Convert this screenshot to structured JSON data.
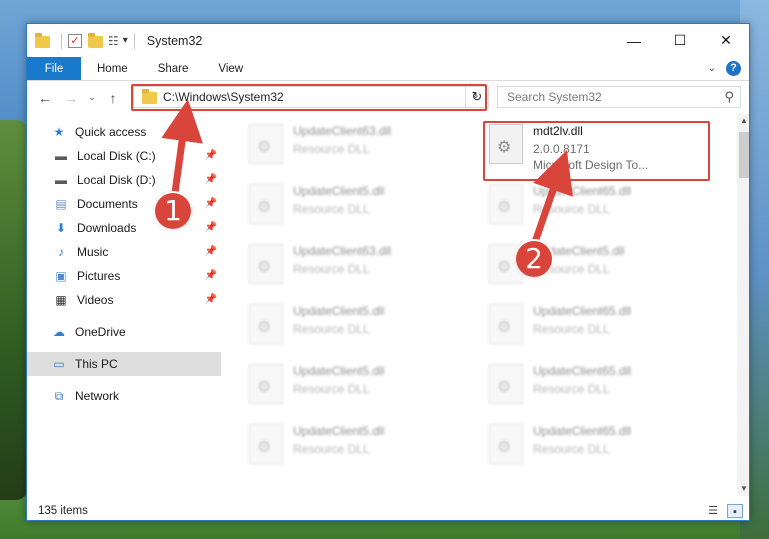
{
  "window": {
    "title": "System32",
    "controls": {
      "minimize": "—",
      "maximize": "☐",
      "close": "✕"
    }
  },
  "ribbon": {
    "file_tab": "File",
    "tabs": [
      "Home",
      "Share",
      "View"
    ]
  },
  "navigation": {
    "back": "←",
    "forward": "→",
    "recent": "⌄",
    "up": "↑",
    "address": "C:\\Windows\\System32",
    "refresh": "↻",
    "search_placeholder": "Search System32"
  },
  "sidebar": {
    "items": [
      {
        "label": "Quick access",
        "icon": "star-icon",
        "pinned": false,
        "level": "top"
      },
      {
        "label": "Local Disk (C:)",
        "icon": "drive-icon",
        "pinned": true,
        "level": "child"
      },
      {
        "label": "Local Disk (D:)",
        "icon": "drive-icon",
        "pinned": true,
        "level": "child"
      },
      {
        "label": "Documents",
        "icon": "documents-icon",
        "pinned": true,
        "level": "child"
      },
      {
        "label": "Downloads",
        "icon": "download-icon",
        "pinned": true,
        "level": "child"
      },
      {
        "label": "Music",
        "icon": "music-icon",
        "pinned": true,
        "level": "child"
      },
      {
        "label": "Pictures",
        "icon": "pictures-icon",
        "pinned": true,
        "level": "child"
      },
      {
        "label": "Videos",
        "icon": "videos-icon",
        "pinned": true,
        "level": "child"
      },
      {
        "label": "OneDrive",
        "icon": "cloud-icon",
        "pinned": false,
        "level": "top"
      },
      {
        "label": "This PC",
        "icon": "computer-icon",
        "pinned": false,
        "level": "top",
        "selected": true
      },
      {
        "label": "Network",
        "icon": "network-icon",
        "pinned": false,
        "level": "top"
      }
    ]
  },
  "files": {
    "highlighted": {
      "name": "mdt2lv.dll",
      "version": "2.0.0.8171",
      "description": "Microsoft Design To..."
    },
    "left_column": [
      {
        "name": "UpdateClient63.dll",
        "type": "Resource DLL"
      },
      {
        "name": "UpdateClient5.dll",
        "type": "Resource DLL"
      },
      {
        "name": "UpdateClient63.dll",
        "type": "Resource DLL"
      },
      {
        "name": "UpdateClient5.dll",
        "type": "Resource DLL"
      },
      {
        "name": "UpdateClient5.dll",
        "type": "Resource DLL"
      },
      {
        "name": "UpdateClient5.dll",
        "type": "Resource DLL"
      }
    ],
    "right_column": [
      {
        "name": "UpdateClient65.dll",
        "type": "Resource DLL"
      },
      {
        "name": "UpdateClient5.dll",
        "type": "Resource DLL"
      },
      {
        "name": "UpdateClient65.dll",
        "type": "Resource DLL"
      },
      {
        "name": "UpdateClient65.dll",
        "type": "Resource DLL"
      },
      {
        "name": "UpdateClient65.dll",
        "type": "Resource DLL"
      }
    ]
  },
  "status": {
    "item_count": "135 items"
  },
  "annotations": {
    "callout_1": "1",
    "callout_2": "2",
    "highlight_color": "#d9443b"
  }
}
